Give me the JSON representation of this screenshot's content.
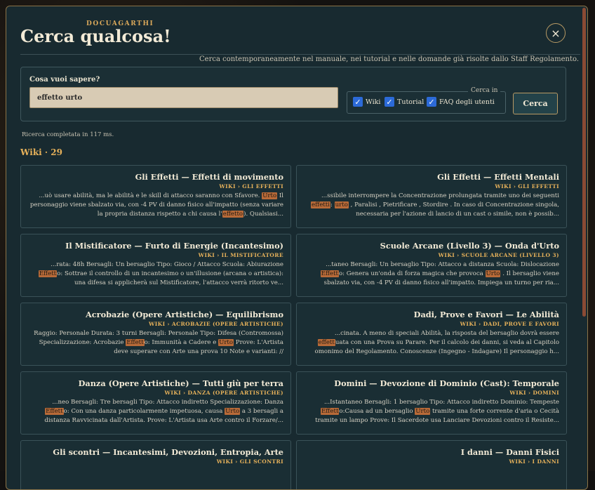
{
  "brand": "DOCUAGARTHI",
  "title": "Cerca qualcosa!",
  "close_icon": "×",
  "subtitle": "Cerca contemporaneamente nel manuale, nei tutorial e nelle domande già risolte dallo Staff Regolamento.",
  "search": {
    "label": "Cosa vuoi sapere?",
    "value": "effetto urto",
    "sources_legend": "Cerca in",
    "sources": [
      {
        "label": "Wiki",
        "checked": true
      },
      {
        "label": "Tutorial",
        "checked": true
      },
      {
        "label": "FAQ degli utenti",
        "checked": true
      }
    ],
    "button": "Cerca"
  },
  "status": "Ricerca completata in 117 ms.",
  "section_title": "Wiki · 29",
  "colors": {
    "accent": "#e6b15a",
    "highlight": "#b86a38",
    "panel": "#182a30"
  },
  "results": [
    {
      "title": "Gli Effetti — Effetti di movimento",
      "crumb": "WIKI › GLI EFFETTI",
      "snippet": [
        {
          "t": "...uò usare abilità, ma le abilità e le skill di attacco saranno con Sfavore. "
        },
        {
          "t": "Urto",
          "h": true
        },
        {
          "t": " Il personaggio viene sbalzato via, con -4 PV di danno fisico all'impatto (senza variare la propria distanza rispetto a chi causa l'"
        },
        {
          "t": "effetto",
          "h": true
        },
        {
          "t": "). Qualsiasi..."
        }
      ]
    },
    {
      "title": "Gli Effetti — Effetti Mentali",
      "crumb": "WIKI › GLI EFFETTI",
      "snippet": [
        {
          "t": "...ssibile interrompere la Concentrazione prolungata tramite uno dei seguenti "
        },
        {
          "t": "effetti",
          "h": true
        },
        {
          "t": ": "
        },
        {
          "t": "urto",
          "h": true
        },
        {
          "t": " , Paralisi , Pietrificare , Stordire . In caso di Concentrazione singola, necessaria per l'azione di lancio di un cast o simile, non è possib..."
        }
      ]
    },
    {
      "title": "Il Mistificatore — Furto di Energie (Incantesimo)",
      "crumb": "WIKI › IL MISTIFICATORE",
      "snippet": [
        {
          "t": "...rata: 48h Bersagli: Un bersaglio Tipo: Gioco / Attacco Scuola: Abiurazione "
        },
        {
          "t": "Effett",
          "h": true
        },
        {
          "t": "o: Sottrae il controllo di un incantesimo o un'illusione (arcana o artistica): una difesa si applicherà sul Mistificatore, l'attacco verrà ritorto ve..."
        }
      ]
    },
    {
      "title": "Scuole Arcane (Livello 3) — Onda d'Urto",
      "crumb": "WIKI › SCUOLE ARCANE (LIVELLO 3)",
      "snippet": [
        {
          "t": "...taneo Bersagli: Un bersaglio Tipo: Attacco a distanza Scuola: Dislocazione "
        },
        {
          "t": "Effett",
          "h": true
        },
        {
          "t": "o: Genera un'onda di forza magica che provoca "
        },
        {
          "t": "Urto",
          "h": true
        },
        {
          "t": " . Il bersaglio viene sbalzato via, con -4 PV di danno fisico all'impatto. Impiega un turno per ria..."
        }
      ]
    },
    {
      "title": "Acrobazie (Opere Artistiche) — Equilibrismo",
      "crumb": "WIKI › ACROBAZIE (OPERE ARTISTICHE)",
      "snippet": [
        {
          "t": "Raggio: Personale Durata: 3 turni Bersagli: Personale Tipo: Difesa (Contromossa) Specializzazione: Acrobazie "
        },
        {
          "t": "Effett",
          "h": true
        },
        {
          "t": "o: Immunità a Cadere e "
        },
        {
          "t": "Urto",
          "h": true
        },
        {
          "t": " Prove: L'Artista deve superare con Arte una prova 10 Note e varianti: //"
        }
      ]
    },
    {
      "title": "Dadi, Prove e Favori — Le Abilità",
      "crumb": "WIKI › DADI, PROVE E FAVORI",
      "snippet": [
        {
          "t": "...cinata. A meno di speciali Abilità, la risposta del bersaglio dovrà essere "
        },
        {
          "t": "effett",
          "h": true
        },
        {
          "t": "uata con una Prova su Parare. Per il calcolo dei danni, si veda al Capitolo omonimo del Regolamento. Conoscenze (Ingegno - Indagare) Il personaggio h..."
        }
      ]
    },
    {
      "title": "Danza (Opere Artistiche) — Tutti giù per terra",
      "crumb": "WIKI › DANZA (OPERE ARTISTICHE)",
      "snippet": [
        {
          "t": "...neo Bersagli: Tre bersagli Tipo: Attacco indiretto Specializzazione: Danza "
        },
        {
          "t": "Effett",
          "h": true
        },
        {
          "t": "o: Con una danza particolarmente impetuosa, causa "
        },
        {
          "t": "Urto",
          "h": true
        },
        {
          "t": " a 3 bersagli a distanza Ravvicinata dall'Artista. Prove: L'Artista usa Arte contro il Forzare/..."
        }
      ]
    },
    {
      "title": "Domini — Devozione di Dominio (Cast): Temporale",
      "crumb": "WIKI › DOMINI",
      "snippet": [
        {
          "t": "...Istantaneo Bersagli: 1 bersaglio Tipo: Attacco indiretto Dominio: Tempeste "
        },
        {
          "t": "Effett",
          "h": true
        },
        {
          "t": "o:Causa ad un bersaglio "
        },
        {
          "t": "Urto",
          "h": true
        },
        {
          "t": " tramite una forte corrente d'aria o Cecità tramite un lampo Prove: Il Sacerdote usa Lanciare Devozioni contro il Resiste..."
        }
      ]
    },
    {
      "title": "Gli scontri — Incantesimi, Devozioni, Entropia, Arte",
      "crumb": "WIKI › GLI SCONTRI",
      "snippet": [
        {
          "t": ""
        }
      ]
    },
    {
      "title": "I danni — Danni Fisici",
      "crumb": "WIKI › I DANNI",
      "snippet": [
        {
          "t": ""
        }
      ]
    }
  ]
}
